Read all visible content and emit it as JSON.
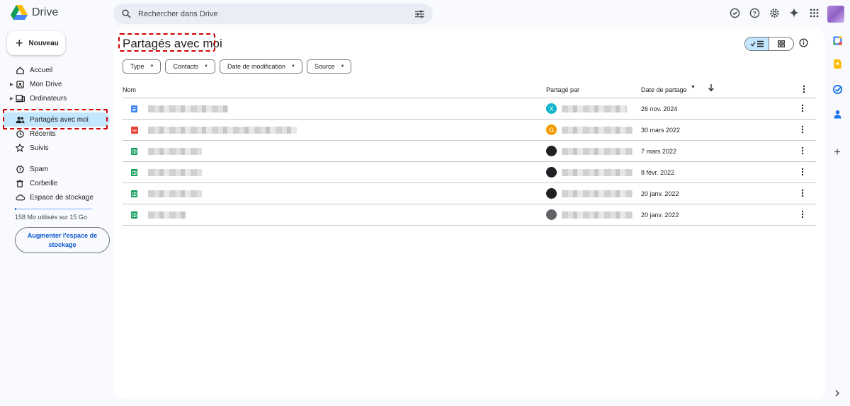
{
  "app": {
    "name": "Drive"
  },
  "search": {
    "placeholder": "Rechercher dans Drive"
  },
  "sidebar": {
    "new_label": "Nouveau",
    "items": [
      {
        "label": "Accueil"
      },
      {
        "label": "Mon Drive"
      },
      {
        "label": "Ordinateurs"
      },
      {
        "label": "Partagés avec moi"
      },
      {
        "label": "Récents"
      },
      {
        "label": "Suivis"
      },
      {
        "label": "Spam"
      },
      {
        "label": "Corbeille"
      },
      {
        "label": "Espace de stockage"
      }
    ],
    "storage_text": "158 Mo utilisés sur 15 Go",
    "storage_fraction": 0.01,
    "upgrade_label": "Augmenter l'espace de stockage"
  },
  "main": {
    "title": "Partagés avec moi",
    "filters": [
      "Type",
      "Contacts",
      "Date de modification",
      "Source"
    ],
    "columns": {
      "name": "Nom",
      "shared_by": "Partagé par",
      "share_date": "Date de partage"
    },
    "rows": [
      {
        "type": "doc",
        "avatar_letter": "X",
        "avatar_color": "#12b5cb",
        "date": "26 nov. 2024"
      },
      {
        "type": "pdf",
        "avatar_letter": "G",
        "avatar_color": "#f29900",
        "date": "30 mars 2022"
      },
      {
        "type": "sheet",
        "avatar_letter": "",
        "avatar_color": "#202124",
        "date": "7 mars 2022"
      },
      {
        "type": "sheet",
        "avatar_letter": "",
        "avatar_color": "#202124",
        "date": "8 févr. 2022"
      },
      {
        "type": "sheet",
        "avatar_letter": "",
        "avatar_color": "#202124",
        "date": "20 janv. 2022"
      },
      {
        "type": "sheet",
        "avatar_letter": "",
        "avatar_color": "#5f6368",
        "date": "20 janv. 2022"
      }
    ]
  },
  "colors": {
    "accent": "#0b57d0",
    "active_bg": "#c2e7ff",
    "highlight": "#d00000"
  }
}
